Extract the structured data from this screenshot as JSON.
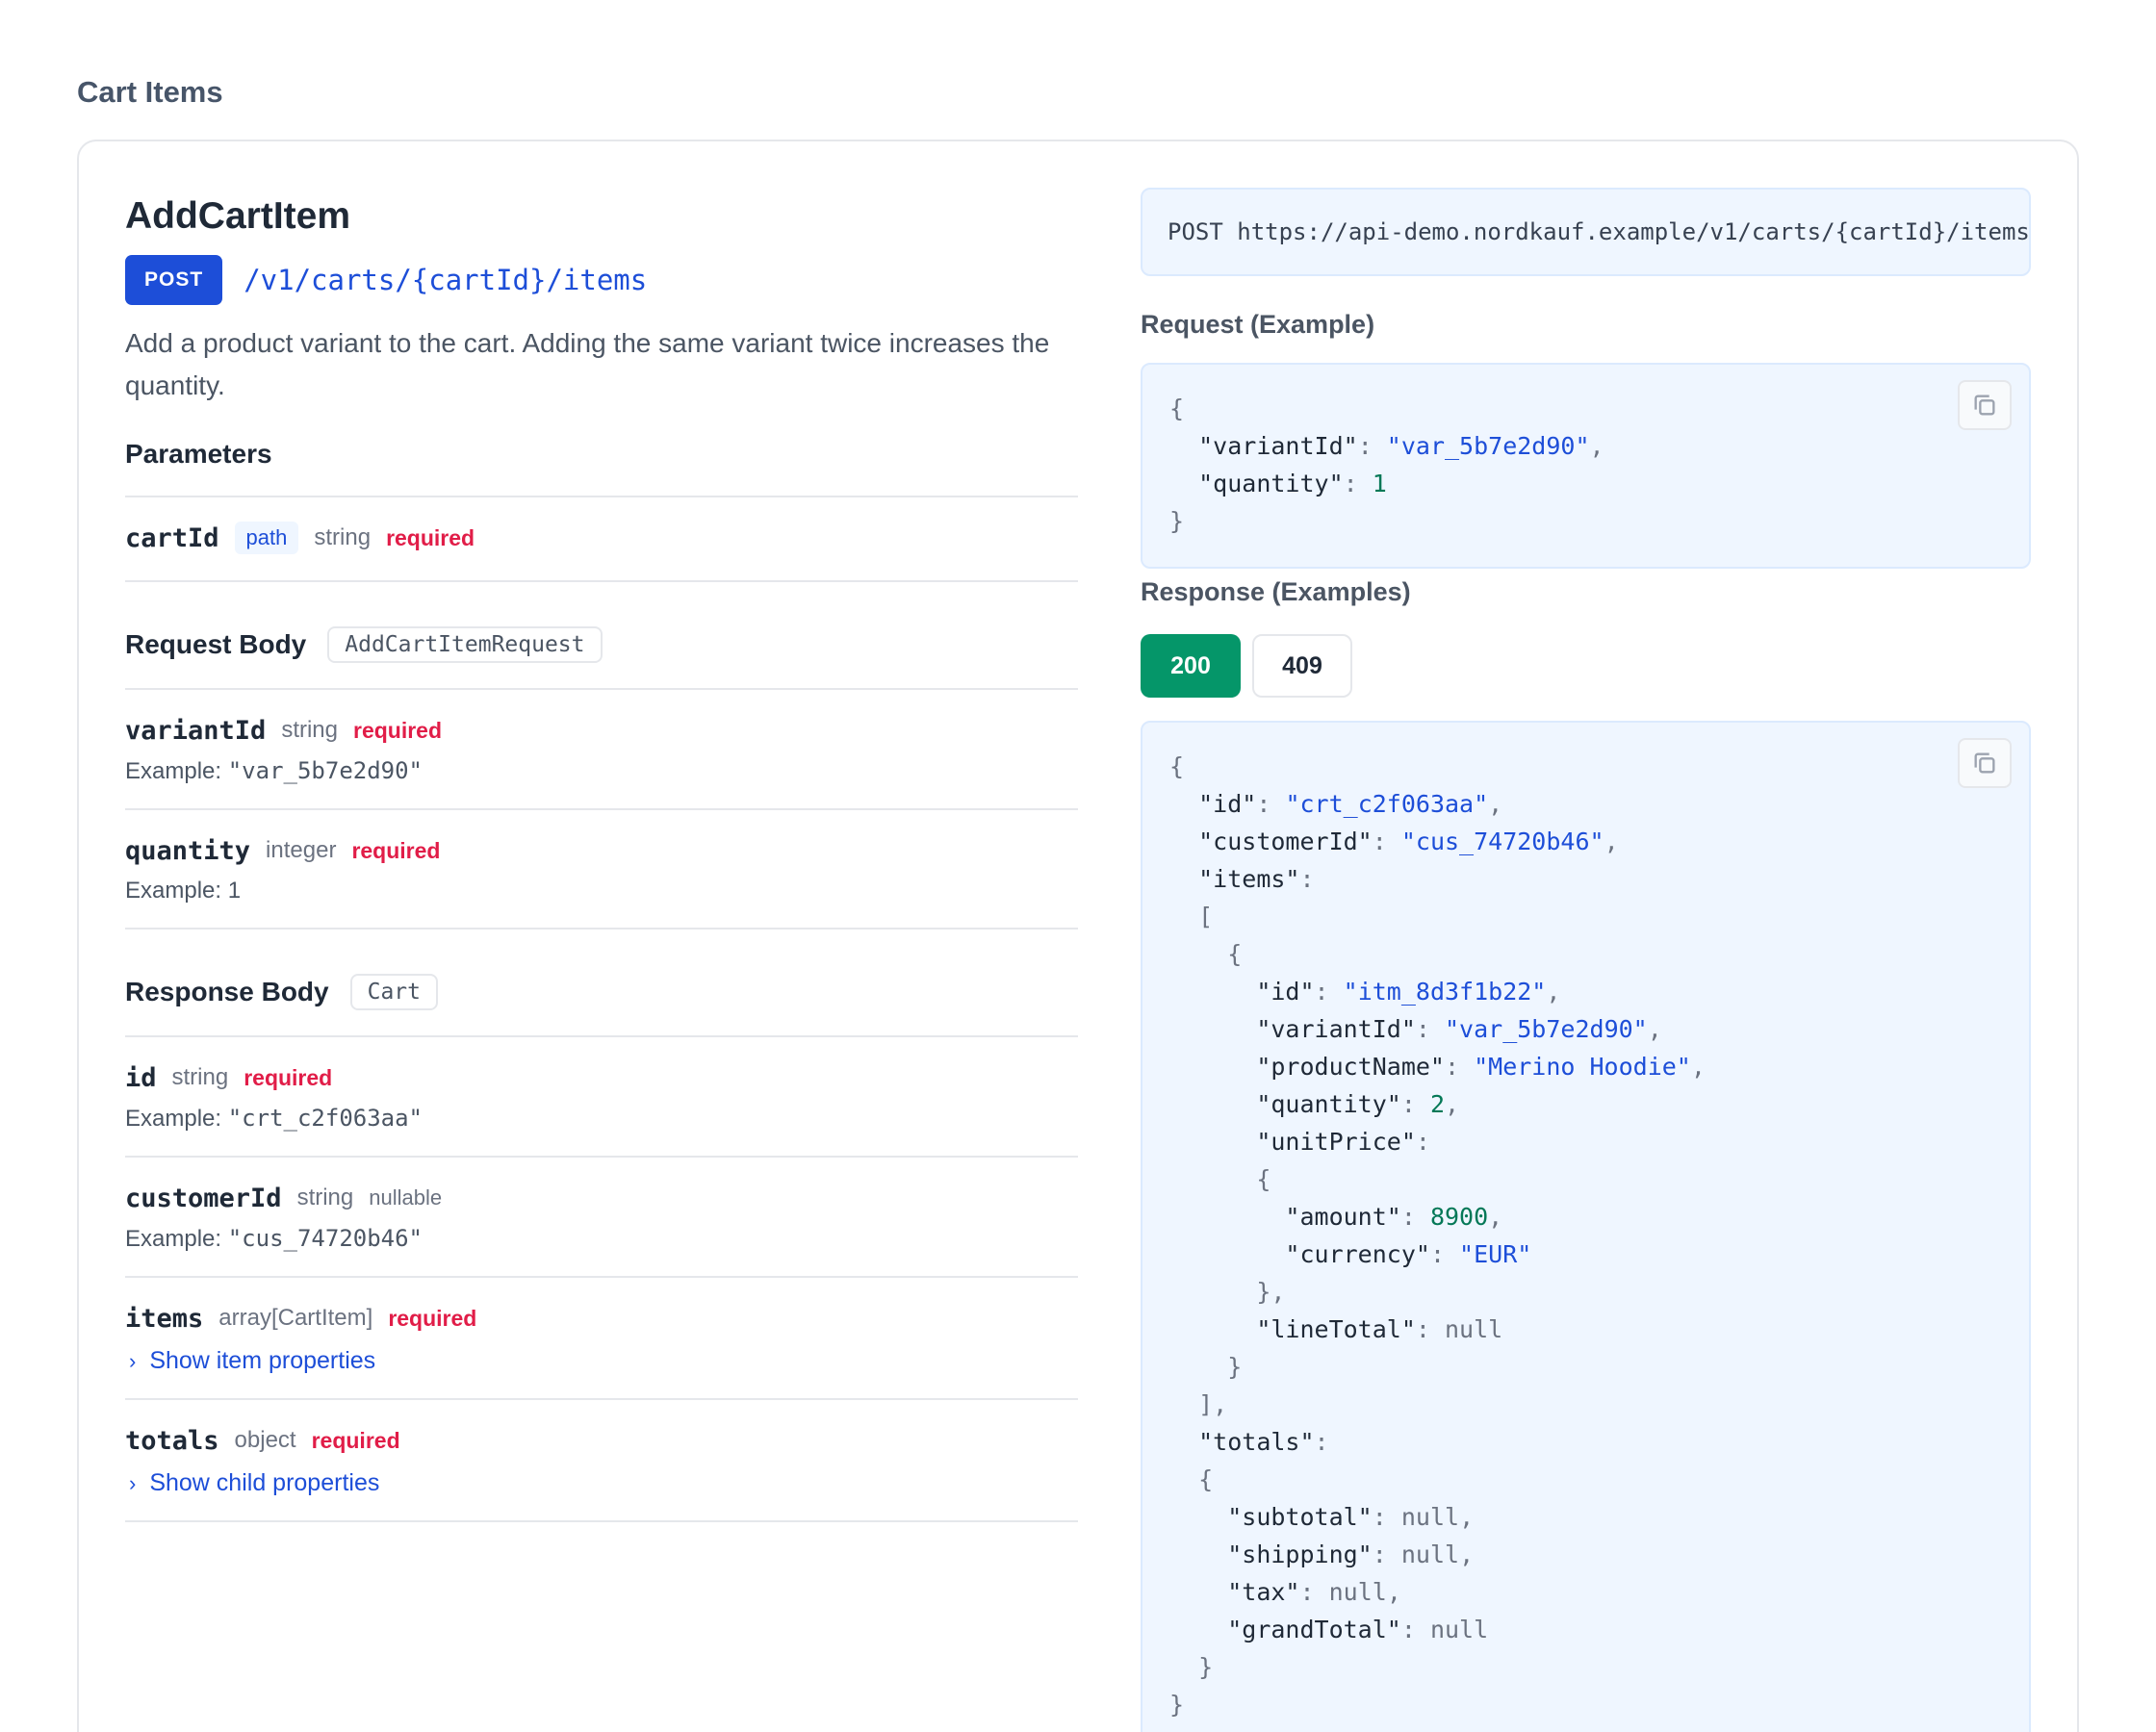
{
  "section_title": "Cart Items",
  "operation": {
    "title": "AddCartItem",
    "method": "POST",
    "path": "/v1/carts/{cartId}/items",
    "description": "Add a product variant to the cart. Adding the same variant twice increases the quantity."
  },
  "parameters": {
    "title": "Parameters",
    "items": [
      {
        "name": "cartId",
        "location": "path",
        "type": "string",
        "required": "required"
      }
    ]
  },
  "request_body": {
    "title": "Request Body",
    "schema": "AddCartItemRequest",
    "fields": [
      {
        "name": "variantId",
        "type": "string",
        "required": "required",
        "example_label": "Example:",
        "example": "\"var_5b7e2d90\""
      },
      {
        "name": "quantity",
        "type": "integer",
        "required": "required",
        "example_label": "Example:",
        "example": "1"
      }
    ]
  },
  "response_body": {
    "title": "Response Body",
    "schema": "Cart",
    "fields": [
      {
        "name": "id",
        "type": "string",
        "required": "required",
        "example_label": "Example:",
        "example": "\"crt_c2f063aa\""
      },
      {
        "name": "customerId",
        "type": "string",
        "nullable": "nullable",
        "example_label": "Example:",
        "example": "\"cus_74720b46\""
      },
      {
        "name": "items",
        "type": "array[CartItem]",
        "required": "required",
        "toggle": "Show item properties"
      },
      {
        "name": "totals",
        "type": "object",
        "required": "required",
        "toggle": "Show child properties"
      }
    ]
  },
  "right": {
    "url": "POST https://api-demo.nordkauf.example/v1/carts/{cartId}/items",
    "request_label": "Request (Example)",
    "response_label": "Response (Examples)",
    "tabs": [
      {
        "label": "200",
        "active": true
      },
      {
        "label": "409",
        "active": false
      }
    ],
    "request_example": {
      "variantId": "\"var_5b7e2d90\"",
      "quantity": "1"
    },
    "response_example": {
      "id": "\"crt_c2f063aa\"",
      "customerId": "\"cus_74720b46\"",
      "item_id": "\"itm_8d3f1b22\"",
      "item_variantId": "\"var_5b7e2d90\"",
      "item_productName": "\"Merino Hoodie\"",
      "item_quantity": "2",
      "amount": "8900",
      "currency": "\"EUR\"",
      "lineTotal": "null",
      "subtotal": "null",
      "shipping": "null",
      "tax": "null",
      "grandTotal": "null"
    }
  },
  "colors": {
    "accent_blue": "#1d4ed8",
    "required_red": "#e11d48",
    "success_green": "#059669"
  }
}
